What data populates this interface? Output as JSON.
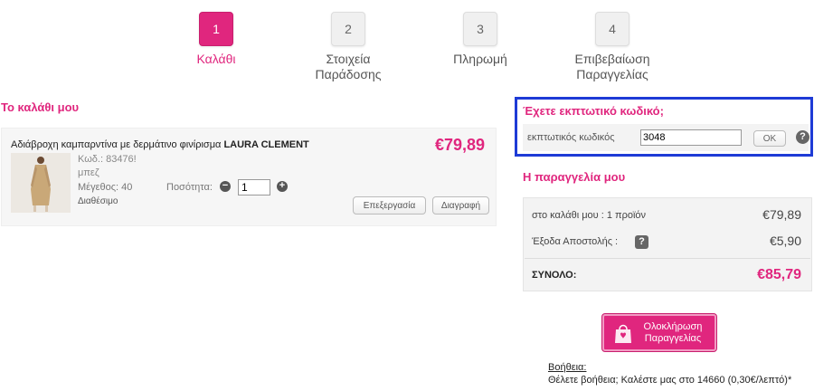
{
  "steps": [
    {
      "number": "1",
      "label": "Καλάθι"
    },
    {
      "number": "2",
      "label_line1": "Στοιχεία",
      "label_line2": "Παράδοσης"
    },
    {
      "number": "3",
      "label": "Πληρωμή"
    },
    {
      "number": "4",
      "label_line1": "Επιβεβαίωση",
      "label_line2": "Παραγγελίας"
    }
  ],
  "cart": {
    "title": "Το καλάθι μου",
    "item": {
      "name": "Αδιάβροχη καμπαρντίνα με δερμάτινο φινίρισμα",
      "brand": "LAURA CLEMENT",
      "price": "€79,89",
      "code": "Κωδ.: 83476!",
      "color": "μπεζ",
      "size": "Μέγεθος: 40",
      "availability": "Διαθέσιμο",
      "quantity_label": "Ποσότητα:",
      "quantity_value": "1",
      "minus": "−",
      "plus": "+",
      "edit_label": "Επεξεργασία",
      "delete_label": "Διαγραφή"
    }
  },
  "coupon": {
    "title": "Έχετε εκπτωτικό κωδικό;",
    "label": "εκπτωτικός κωδικός",
    "value": "3048",
    "ok_label": "OK",
    "help": "?"
  },
  "order": {
    "title": "Η παραγγελία μου",
    "cart_label": "στο καλάθι μου : 1 προϊόν",
    "cart_value": "€79,89",
    "shipping_label": "Έξοδα Αποστολής :",
    "shipping_help": "?",
    "shipping_value": "€5,90",
    "total_label": "ΣΥΝΟΛΟ:",
    "total_value": "€85,79",
    "checkout_line1": "Ολοκλήρωση",
    "checkout_line2": "Παραγγελίας"
  },
  "help": {
    "title": "Βοήθεια:",
    "text": "Θέλετε βοήθεια; Καλέστε μας στο 14660 (0,30€/λεπτό)*"
  },
  "colors": {
    "accent": "#e0267e",
    "coupon_border": "#1e3bd6"
  }
}
